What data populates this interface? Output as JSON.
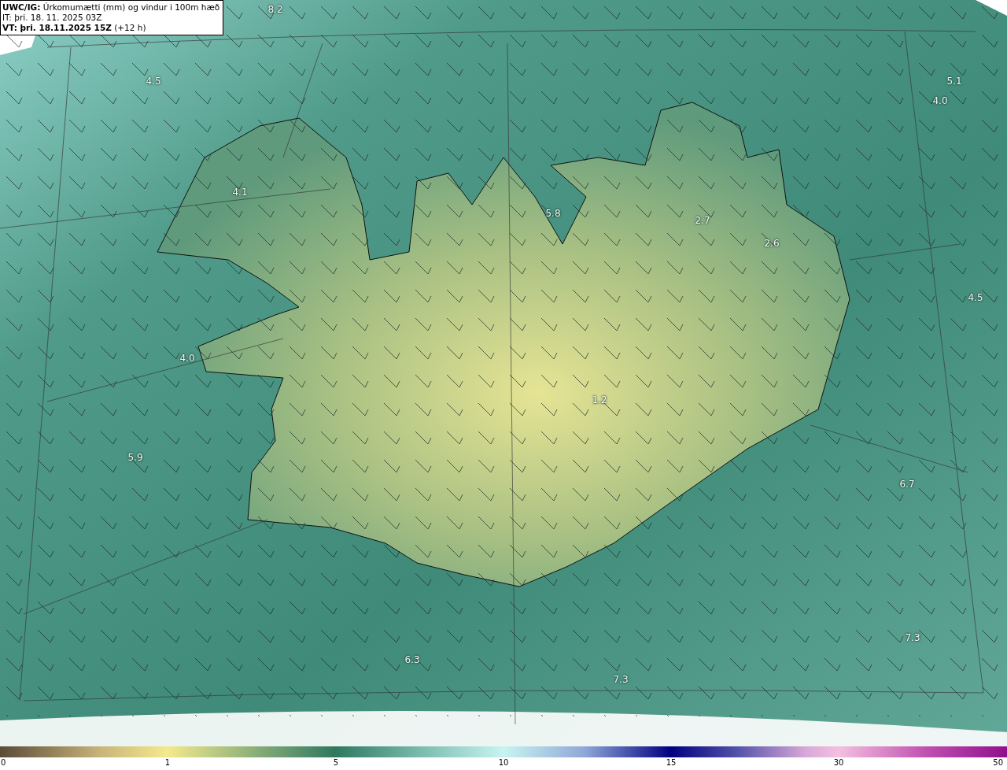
{
  "title_box": {
    "lines": [
      "**UWC/IG:** Úrkomumætti (mm) og vindur i 100m hæð",
      "IT: þri. 18. 11. 2025 03Z",
      "**VT: þri. 18.11.2025 15Z** (+12 h)"
    ]
  },
  "map": {
    "value_labels": [
      "8.2",
      "4.5",
      "5.1",
      "4.0",
      "4.1",
      "5.8",
      "2.7",
      "2.6",
      "4.5",
      "4.0",
      "1.2",
      "5.9",
      "6.7",
      "7.3",
      "6.3",
      "7.3"
    ]
  },
  "colorbar": {
    "ticks": [
      "0",
      "1",
      "5",
      "10",
      "15",
      "30",
      "50"
    ]
  }
}
